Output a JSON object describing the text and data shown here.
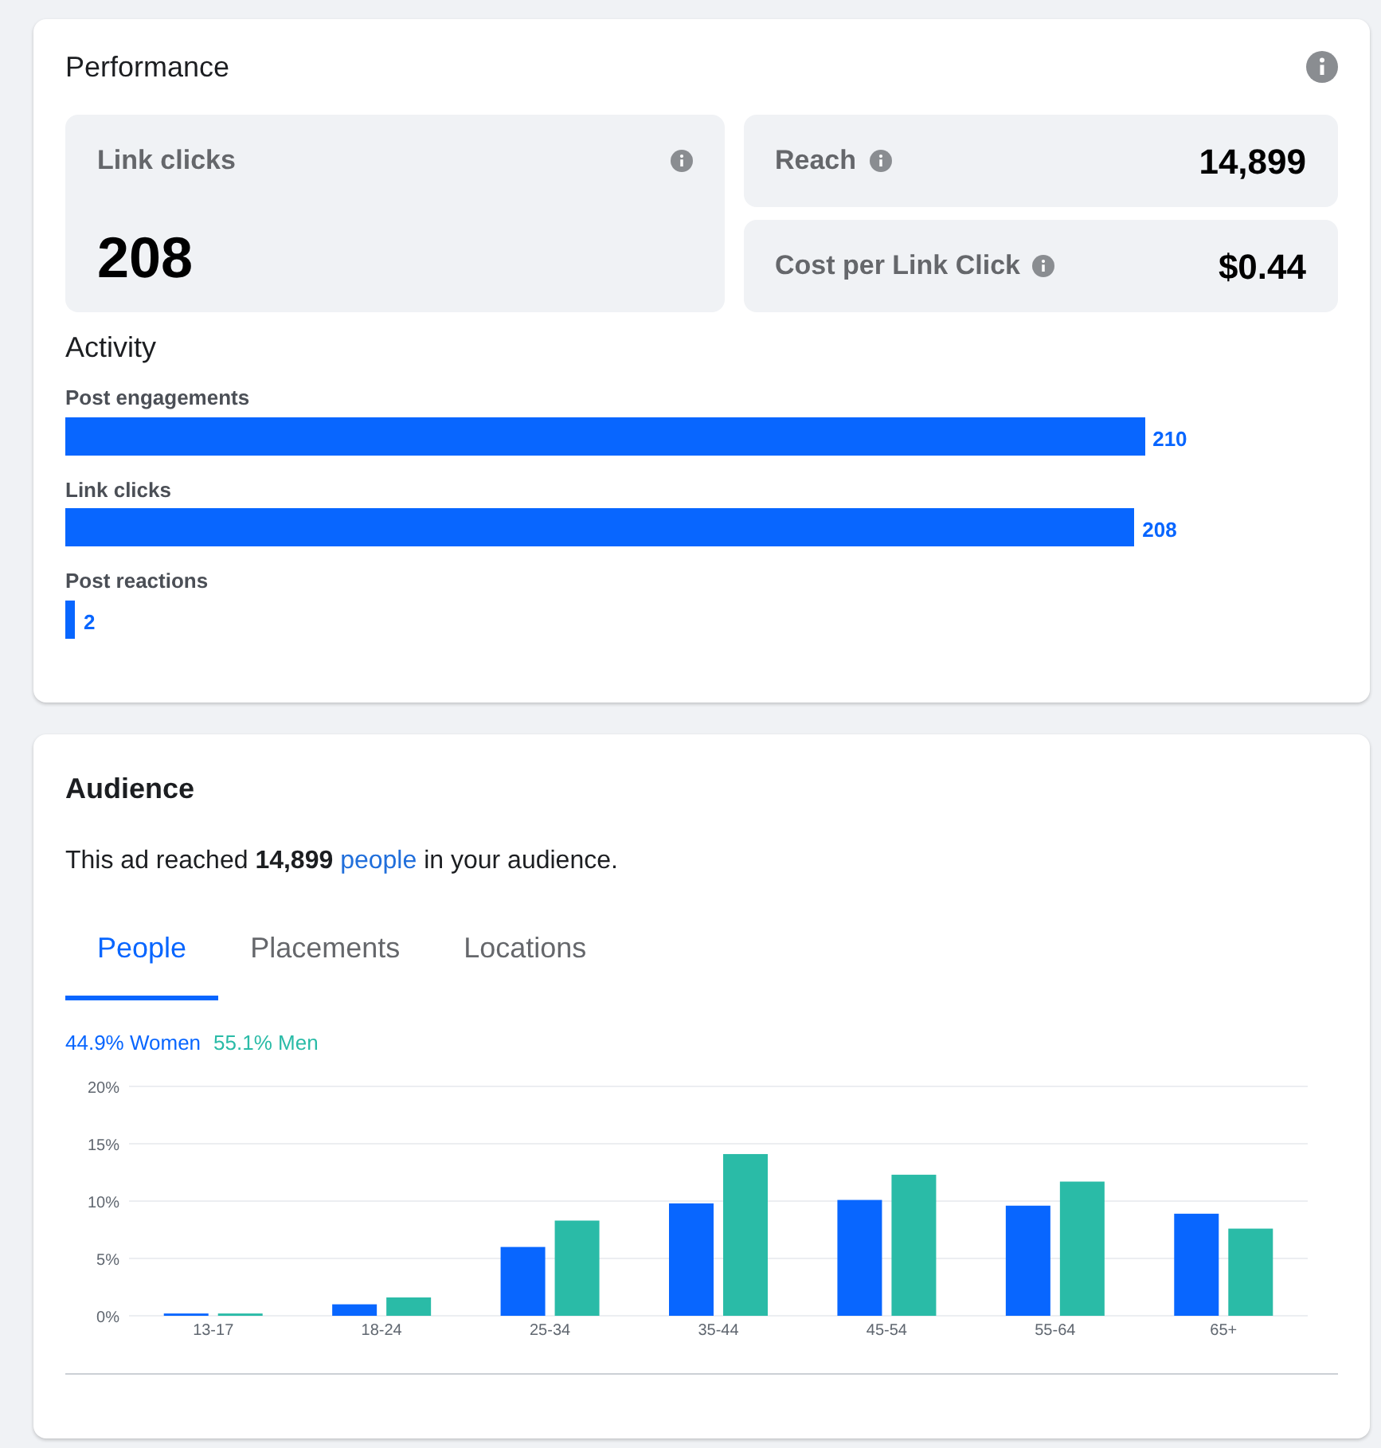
{
  "performance": {
    "title": "Performance",
    "primary": {
      "label": "Link clicks",
      "value": "208"
    },
    "metrics": [
      {
        "label": "Reach",
        "value": "14,899"
      },
      {
        "label": "Cost per Link Click",
        "value": "$0.44"
      }
    ],
    "activity": {
      "title": "Activity",
      "items": [
        {
          "label": "Post engagements",
          "value": "210"
        },
        {
          "label": "Link clicks",
          "value": "208"
        },
        {
          "label": "Post reactions",
          "value": "2"
        }
      ]
    }
  },
  "audience": {
    "title": "Audience",
    "summary": "This ad reached **14,899**",
    "link": "people",
    "summary_end": "in your audience.",
    "tabs": [
      {
        "label": "People",
        "selected": true
      },
      {
        "label": "Placements",
        "selected": false
      },
      {
        "label": "Locations",
        "selected": false
      }
    ],
    "legend": [
      {
        "share": "44.9%"
      },
      {
        "share": "55.1%"
      }
    ],
    "chart_data": {
      "type": "bar",
      "grid": true,
      "categories": [
        "13-17",
        "18-24",
        "25-34",
        "35-44",
        "45-54",
        "55-64",
        "65+"
      ],
      "series": [
        {
          "name": "Women",
          "color": "#0866ff",
          "values": [
            0.2,
            1.0,
            6.0,
            9.8,
            10.1,
            9.6,
            8.9
          ]
        },
        {
          "name": "Men",
          "color": "#2abba7",
          "values": [
            0.2,
            1.6,
            8.3,
            14.1,
            12.3,
            11.7,
            7.6
          ]
        }
      ],
      "ylim": [
        0,
        20
      ],
      "yticks": [
        {
          "value": 0,
          "label": "0%"
        },
        {
          "value": 5,
          "label": "5%"
        },
        {
          "value": 10,
          "label": "10%"
        },
        {
          "value": 15,
          "label": "15%"
        },
        {
          "value": 20,
          "label": "20%"
        }
      ]
    }
  }
}
